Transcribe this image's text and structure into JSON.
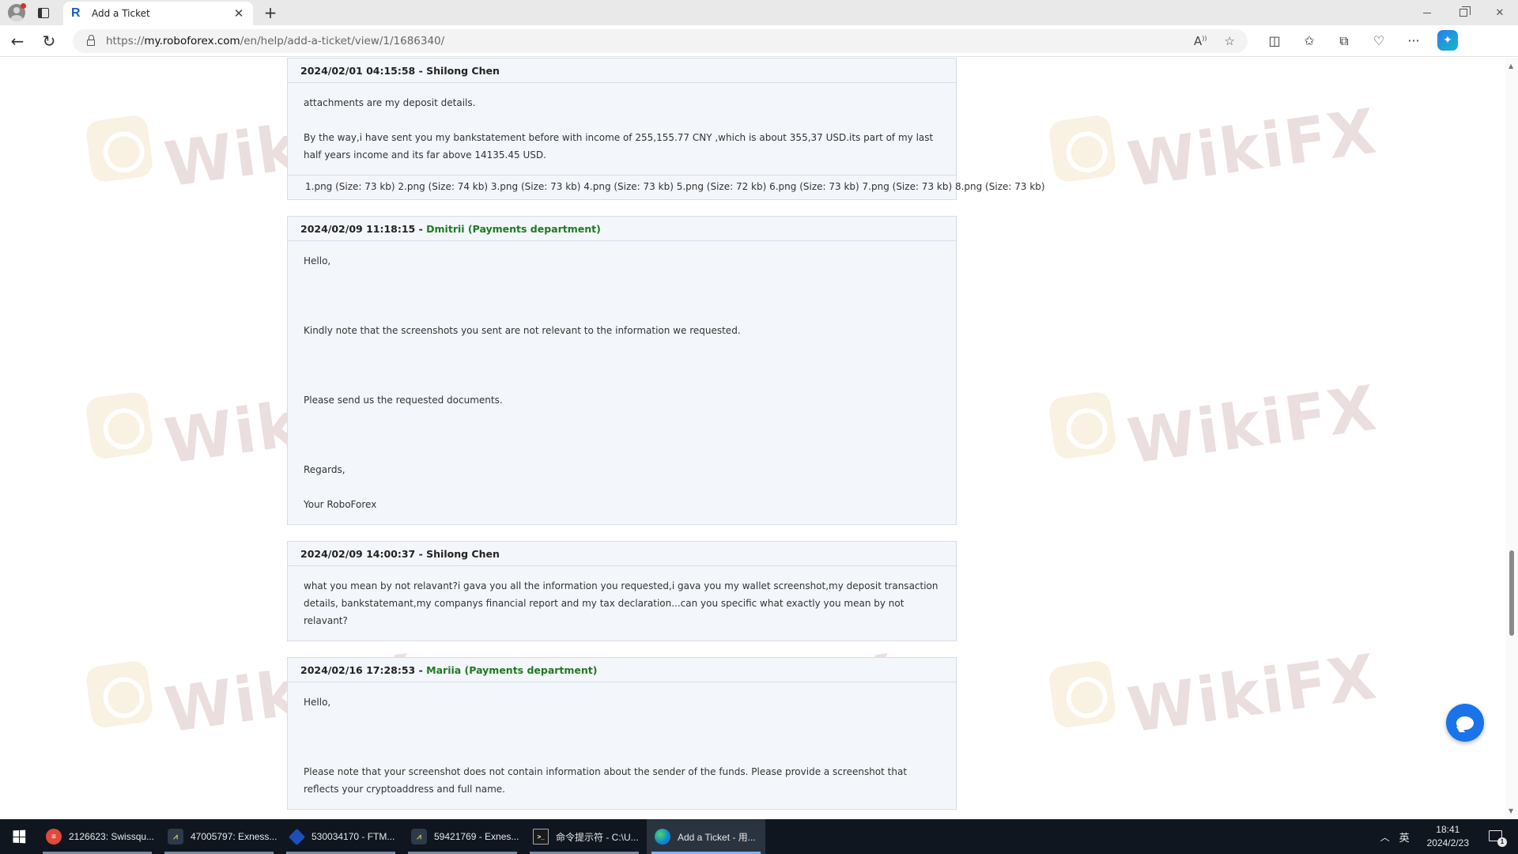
{
  "browser": {
    "tab_title": "Add a Ticket",
    "tab_favicon": "R",
    "url_prefix": "https://",
    "url_host": "my.roboforex.com",
    "url_path": "/en/help/add-a-ticket/view/1/1686340/"
  },
  "watermark": {
    "text": "WikiFX"
  },
  "messages": [
    {
      "timestamp": "2024/02/01 04:15:58",
      "separator": " - ",
      "author": "Shilong Chen",
      "is_staff": false,
      "paragraphs": [
        "attachments are my deposit details.",
        "By the way,i have sent you my bankstatement before with income of 255,155.77 CNY ,which is about 355,37 USD.its part of my last half years income and its far above 14135.45 USD."
      ],
      "attachments": "1.png (Size: 73 kb) 2.png (Size: 74 kb) 3.png (Size: 73 kb) 4.png (Size: 73 kb) 5.png (Size: 72 kb) 6.png (Size: 73 kb) 7.png (Size: 73 kb) 8.png (Size: 73 kb)"
    },
    {
      "timestamp": "2024/02/09 11:18:15",
      "separator": " - ",
      "author": "Dmitrii (Payments department)",
      "is_staff": true,
      "greeting": "Hello,",
      "line1": "Kindly note that the screenshots you sent are not relevant to the information we requested.",
      "line2": "Please send us the requested documents.",
      "regards": "Regards,",
      "signature": "Your RoboForex"
    },
    {
      "timestamp": "2024/02/09 14:00:37",
      "separator": " - ",
      "author": "Shilong Chen",
      "is_staff": false,
      "paragraphs": [
        "what you mean by not relavant?i gava you all the information you requested,i gava you my wallet screenshot,my deposit transaction details, bankstatemant,my companys financial report and my tax declaration...can you specific what exactly you mean by not relavant?"
      ]
    },
    {
      "timestamp": "2024/02/16 17:28:53",
      "separator": " - ",
      "author": "Mariia (Payments department)",
      "is_staff": true,
      "greeting": "Hello,",
      "line1": "Please note that your screenshot does not contain information about the sender of the funds. Please provide a screenshot that reflects your cryptoaddress and full name."
    }
  ],
  "taskbar": {
    "items": [
      {
        "label": "2126623: Swissqu...",
        "icon": "swissquote-icon",
        "icon_text": "≡"
      },
      {
        "label": "47005797: Exness...",
        "icon": "metatrader-icon",
        "icon_text": "⩘"
      },
      {
        "label": "530034170 - FTM...",
        "icon": "ftmo-icon",
        "icon_text": ""
      },
      {
        "label": "59421769 - Exnes...",
        "icon": "metatrader-icon",
        "icon_text": "⩘"
      },
      {
        "label": "命令提示符 - C:\\U...",
        "icon": "cmd-icon",
        "icon_text": ">_"
      },
      {
        "label": "Add a Ticket - 用...",
        "icon": "edge-icon",
        "icon_text": ""
      }
    ],
    "ime": "英",
    "time": "18:41",
    "date": "2024/2/23",
    "notification_count": "1"
  }
}
